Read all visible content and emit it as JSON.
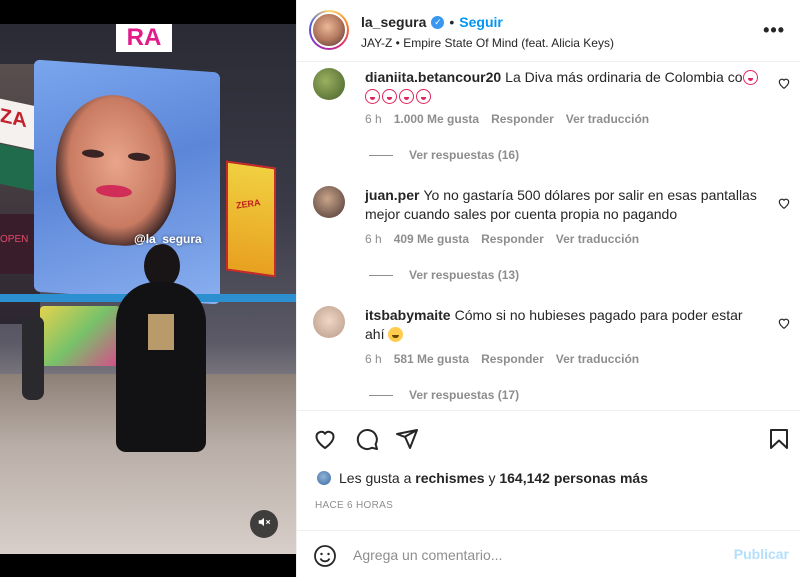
{
  "media": {
    "billboard_handle": "@la_segura",
    "sign_ra": "RA",
    "sign_za": "ZA",
    "sign_open": "OPEN",
    "sign_zera": "ZERA",
    "mute_icon": "speaker-muted-icon"
  },
  "header": {
    "username": "la_segura",
    "separator": "•",
    "follow_label": "Seguir",
    "audio": "JAY-Z • Empire State Of Mind (feat. Alicia Keys)",
    "more_icon": "•••"
  },
  "comments": [
    {
      "user": "dianiita.betancour20",
      "text": "La Diva más ordinaria de Colombia co",
      "time": "6 h",
      "likes": "1.000 Me gusta",
      "reply_label": "Responder",
      "translate_label": "Ver traducción",
      "replies_label": "Ver respuestas (16)"
    },
    {
      "user": "juan.per",
      "text": "Yo no gastaría 500 dólares por salir en esas pantallas mejor cuando sales por cuenta propia no pagando",
      "time": "6 h",
      "likes": "409 Me gusta",
      "reply_label": "Responder",
      "translate_label": "Ver traducción",
      "replies_label": "Ver respuestas (13)"
    },
    {
      "user": "itsbabymaite",
      "text": "Cómo si no hubieses pagado para poder estar ahí",
      "time": "6 h",
      "likes": "581 Me gusta",
      "reply_label": "Responder",
      "translate_label": "Ver traducción",
      "replies_label": "Ver respuestas (17)"
    }
  ],
  "likes_line": {
    "prefix": "Les gusta a",
    "user": "rechismes",
    "connector": "y",
    "count": "164,142",
    "suffix": "personas más"
  },
  "time_ago": "HACE 6 HORAS",
  "comment_box": {
    "placeholder": "Agrega un comentario...",
    "post_label": "Publicar"
  },
  "colors": {
    "accent": "#0095f6",
    "post_disabled": "#b2dffc",
    "muted_text": "#8e8e8e"
  }
}
